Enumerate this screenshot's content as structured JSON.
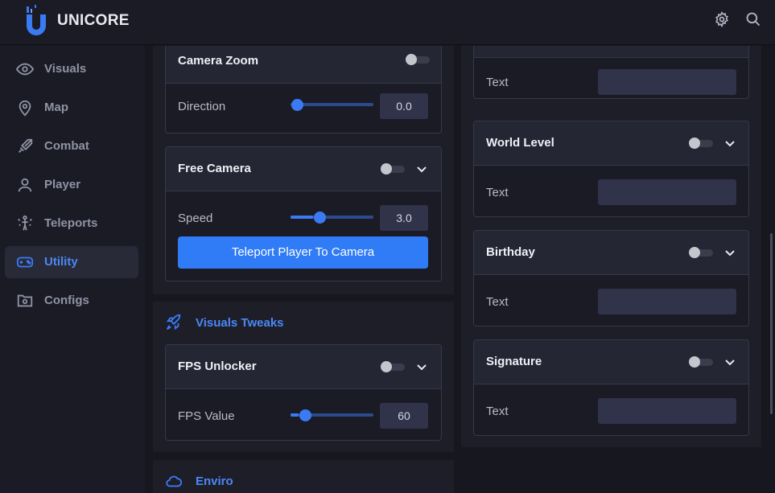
{
  "app": {
    "brand": "UNICORE"
  },
  "header": {
    "icons": [
      "gear-icon",
      "search-icon"
    ]
  },
  "sidebar": {
    "items": [
      {
        "label": "Visuals",
        "icon": "eye-icon",
        "active": false
      },
      {
        "label": "Map",
        "icon": "map-pin-icon",
        "active": false
      },
      {
        "label": "Combat",
        "icon": "sword-icon",
        "active": false
      },
      {
        "label": "Player",
        "icon": "user-icon",
        "active": false
      },
      {
        "label": "Teleports",
        "icon": "teleport-icon",
        "active": false
      },
      {
        "label": "Utility",
        "icon": "gamepad-icon",
        "active": true
      },
      {
        "label": "Configs",
        "icon": "folder-gear-icon",
        "active": false
      }
    ]
  },
  "left": {
    "camera_zoom": {
      "title": "Camera Zoom",
      "enabled": false,
      "direction": {
        "label": "Direction",
        "value": "0.0",
        "fraction": 0.0
      }
    },
    "free_camera": {
      "title": "Free Camera",
      "enabled": false,
      "speed": {
        "label": "Speed",
        "value": "3.0",
        "fraction": 0.27
      },
      "button": "Teleport Player To Camera"
    },
    "visuals_tweaks": {
      "title": "Visuals Tweaks",
      "icon": "rocket-icon",
      "fps_unlocker": {
        "title": "FPS Unlocker",
        "enabled": false,
        "fps_value": {
          "label": "FPS Value",
          "value": "60",
          "fraction": 0.1
        }
      }
    },
    "enviro": {
      "title": "Enviro",
      "icon": "cloud-icon"
    }
  },
  "right": {
    "top_card": {
      "field_label": "Text",
      "field_value": ""
    },
    "world_level": {
      "title": "World Level",
      "enabled": false,
      "field_label": "Text",
      "field_value": ""
    },
    "birthday": {
      "title": "Birthday",
      "enabled": false,
      "field_label": "Text",
      "field_value": ""
    },
    "signature": {
      "title": "Signature",
      "enabled": false,
      "field_label": "Text",
      "field_value": ""
    }
  },
  "colors": {
    "accent": "#3a7bf4",
    "panel": "#1e1e29",
    "card_header": "#252634"
  }
}
